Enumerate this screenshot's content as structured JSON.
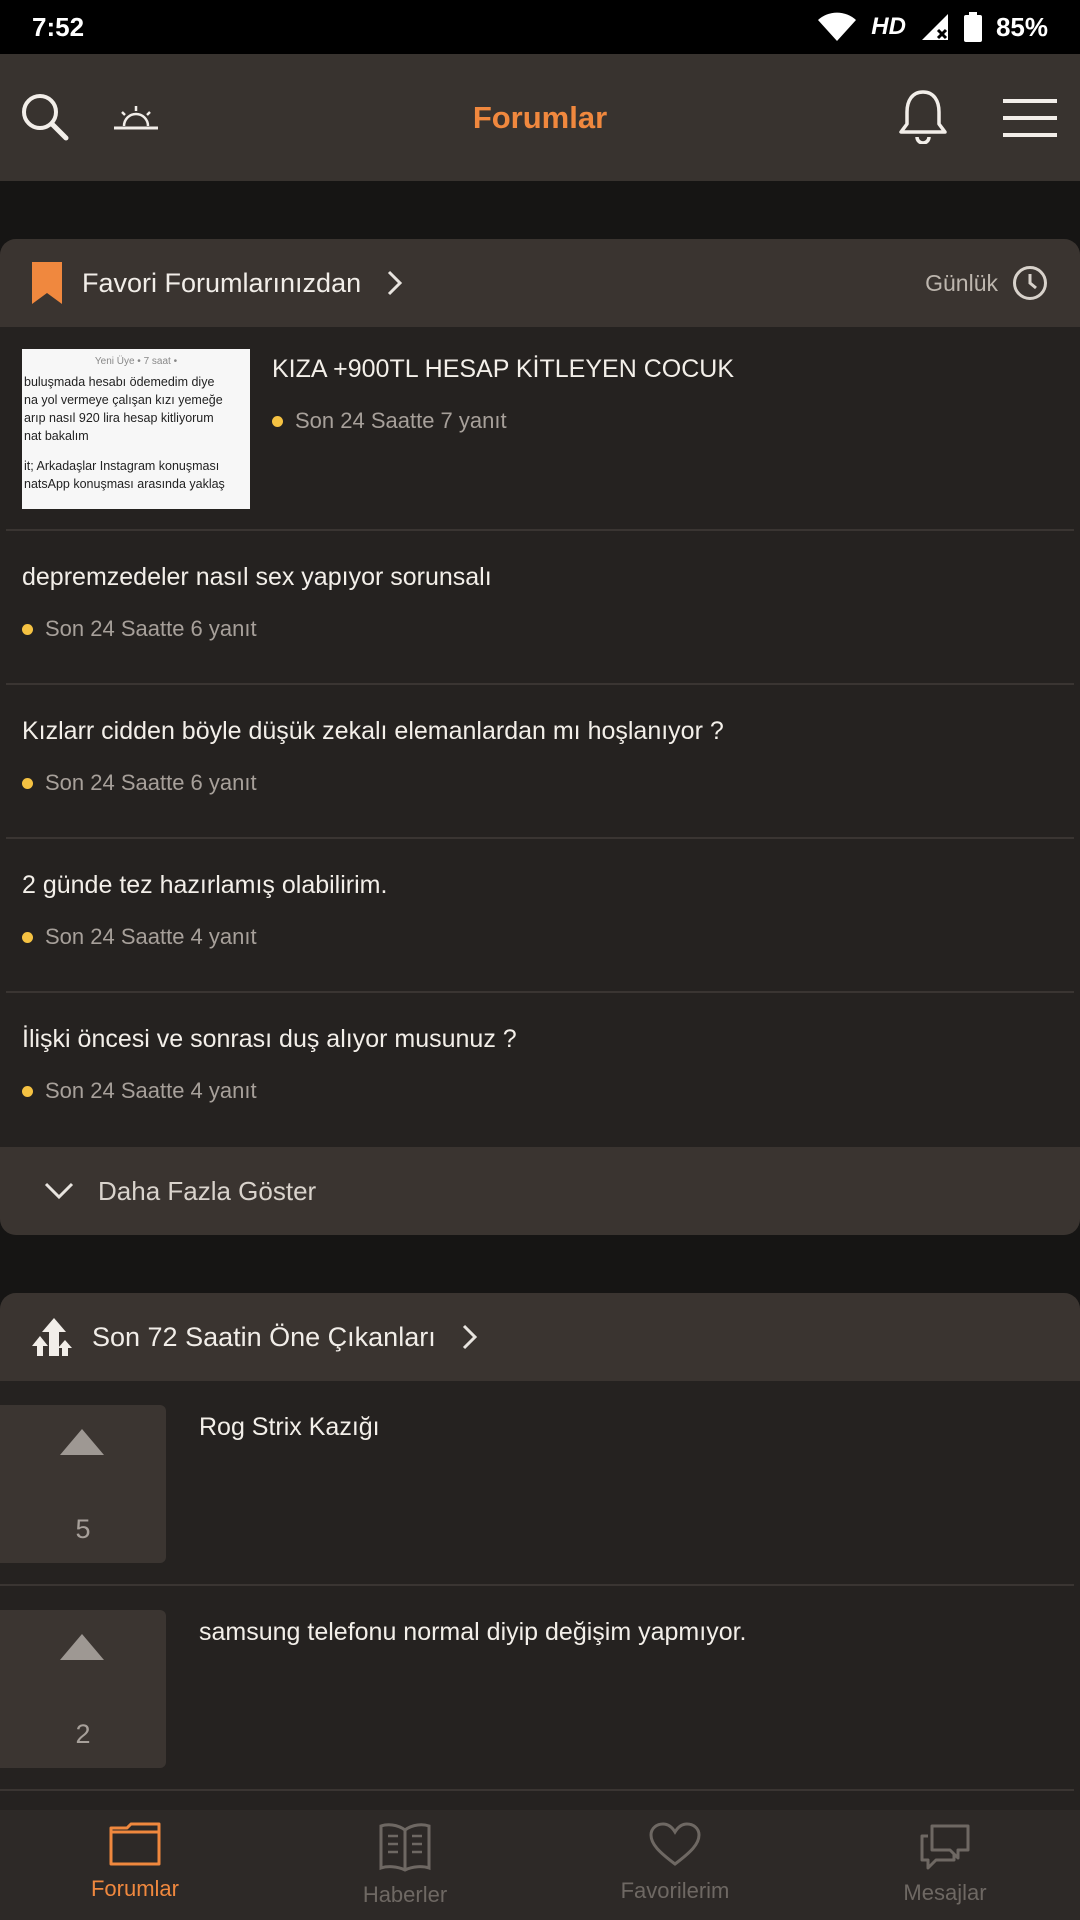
{
  "status_bar": {
    "time": "7:52",
    "network": "HD",
    "battery": "85%"
  },
  "app_bar": {
    "title": "Forumlar"
  },
  "favorites": {
    "header": "Favori Forumlarınızdan",
    "period": "Günlük",
    "topics": [
      {
        "title": "KIZA +900TL HESAP KİTLEYEN COCUK",
        "meta": "Son 24 Saatte 7 yanıt",
        "thumbnail": {
          "top": "Yeni Üye • 7 saat •",
          "lines": [
            "buluşmada hesabı ödemedim diye",
            "na yol vermeye çalışan kızı yemeğe",
            "arıp nasıl 920 lira hesap kitliyorum",
            "nat bakalım",
            "",
            "it; Arkadaşlar Instagram konuşması",
            "natsApp konuşması arasında yaklaş"
          ]
        }
      },
      {
        "title": "depremzedeler nasıl sex yapıyor sorunsalı",
        "meta": "Son 24 Saatte 6 yanıt"
      },
      {
        "title": "Kızlarr cidden böyle düşük zekalı elemanlardan mı hoşlanıyor ?",
        "meta": "Son 24 Saatte 6 yanıt"
      },
      {
        "title": "2 günde tez hazırlamış olabilirim.",
        "meta": "Son 24 Saatte 4 yanıt"
      },
      {
        "title": "İlişki öncesi ve sonrası duş alıyor musunuz ?",
        "meta": "Son 24 Saatte 4 yanıt"
      }
    ],
    "show_more": "Daha Fazla Göster"
  },
  "highlights": {
    "header": "Son 72 Saatin Öne Çıkanları",
    "items": [
      {
        "votes": "5",
        "title": "Rog Strix Kazığı"
      },
      {
        "votes": "2",
        "title": "samsung telefonu normal diyip değişim yapmıyor."
      }
    ]
  },
  "bottom_nav": [
    {
      "label": "Forumlar",
      "icon": "folder-icon"
    },
    {
      "label": "Haberler",
      "icon": "newspaper-icon"
    },
    {
      "label": "Favorilerim",
      "icon": "heart-icon"
    },
    {
      "label": "Mesajlar",
      "icon": "chat-icon"
    }
  ],
  "colors": {
    "accent": "#f0883e",
    "dot": "#f5c242",
    "bookmark": "#f0883e"
  }
}
